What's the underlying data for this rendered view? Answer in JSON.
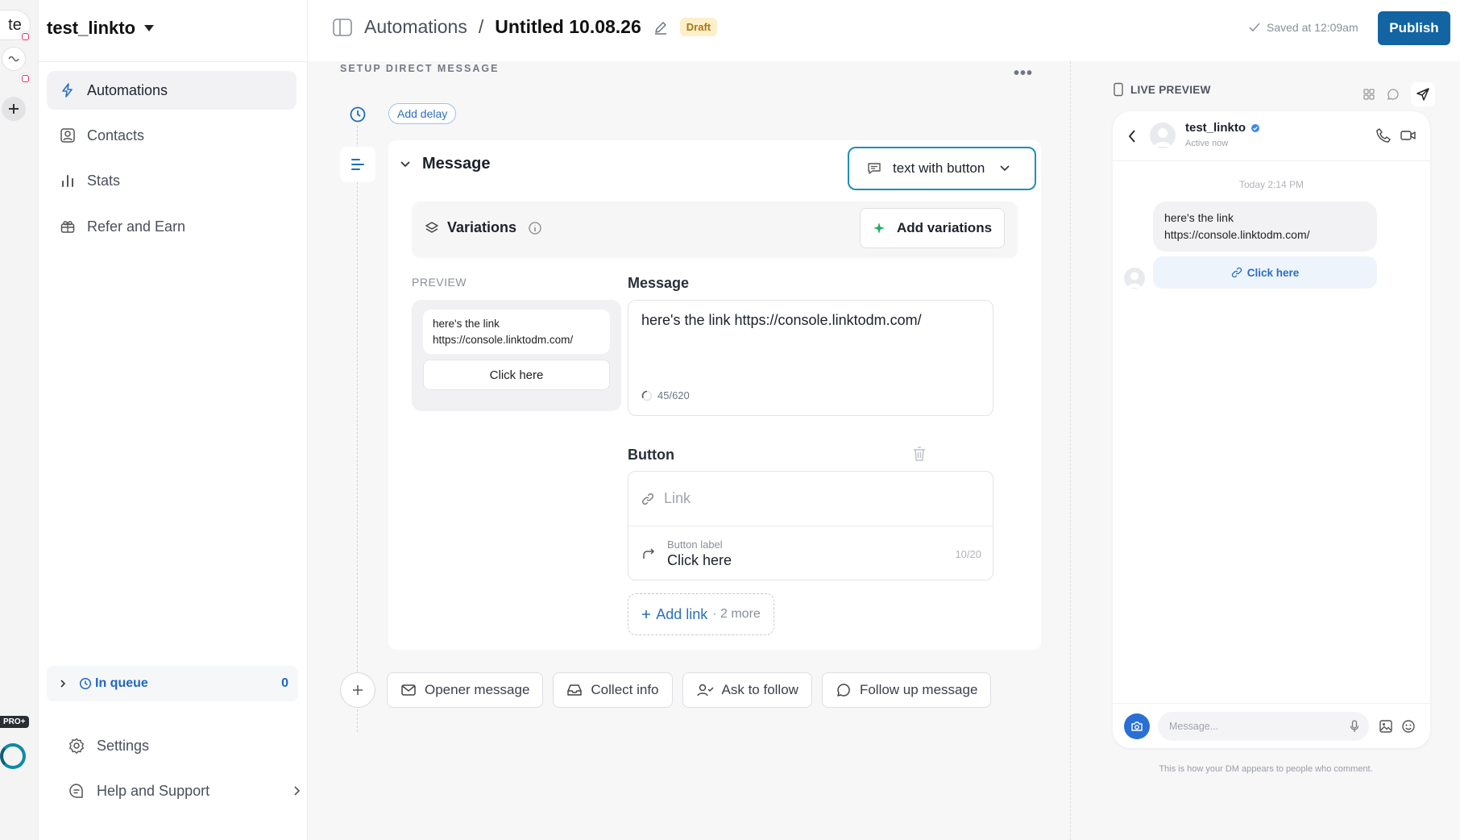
{
  "rail": {
    "workspace_avatar": "te",
    "badge": "PRO+"
  },
  "sidebar": {
    "account_name": "test_linkto",
    "nav": [
      {
        "label": "Automations"
      },
      {
        "label": "Contacts"
      },
      {
        "label": "Stats"
      },
      {
        "label": "Refer and Earn"
      }
    ],
    "queue": {
      "label": "In queue",
      "count": "0"
    },
    "bottom": [
      {
        "label": "Settings"
      },
      {
        "label": "Help and Support"
      }
    ]
  },
  "header": {
    "breadcrumb_root": "Automations",
    "separator": "/",
    "title": "Untitled 10.08.26",
    "status_badge": "Draft",
    "saved_text": "Saved at 12:09am",
    "publish_label": "Publish"
  },
  "main": {
    "section_title": "SETUP DIRECT MESSAGE",
    "more_menu": "•••",
    "add_delay_label": "Add delay",
    "message_title": "Message",
    "message_type": "text with button",
    "variations_label": "Variations",
    "add_variations_label": "Add variations",
    "preview_label": "PREVIEW",
    "preview_text_line1": "here's the link",
    "preview_text_line2": "https://console.linktodm.com/",
    "preview_button": "Click here",
    "message_label": "Message",
    "message_value": "here's the link https://console.linktodm.com/",
    "char_count": "45/620",
    "button_section_label": "Button",
    "link_placeholder": "Link",
    "button_label_caption": "Button label",
    "button_label_value": "Click here",
    "button_label_count": "10/20",
    "add_link_label": "Add link",
    "add_link_more": "· 2 more",
    "step_chips": [
      {
        "label": "Opener message"
      },
      {
        "label": "Collect info"
      },
      {
        "label": "Ask to follow"
      },
      {
        "label": "Follow up message"
      }
    ]
  },
  "live_preview": {
    "title": "LIVE PREVIEW",
    "contact_name": "test_linkto",
    "contact_status": "Active now",
    "timestamp": "Today 2:14 PM",
    "bubble_line1": "here's the link",
    "bubble_line2": "https://console.linktodm.com/",
    "bubble_button": "Click here",
    "input_placeholder": "Message...",
    "footer_note": "This is how your DM appears to people who comment."
  },
  "colors": {
    "accent": "#1264a3",
    "link": "#2b6fc0",
    "type_selector_border": "#1f8ebc",
    "draft_bg": "#fdf0c9",
    "instagram": "#e1306c"
  }
}
